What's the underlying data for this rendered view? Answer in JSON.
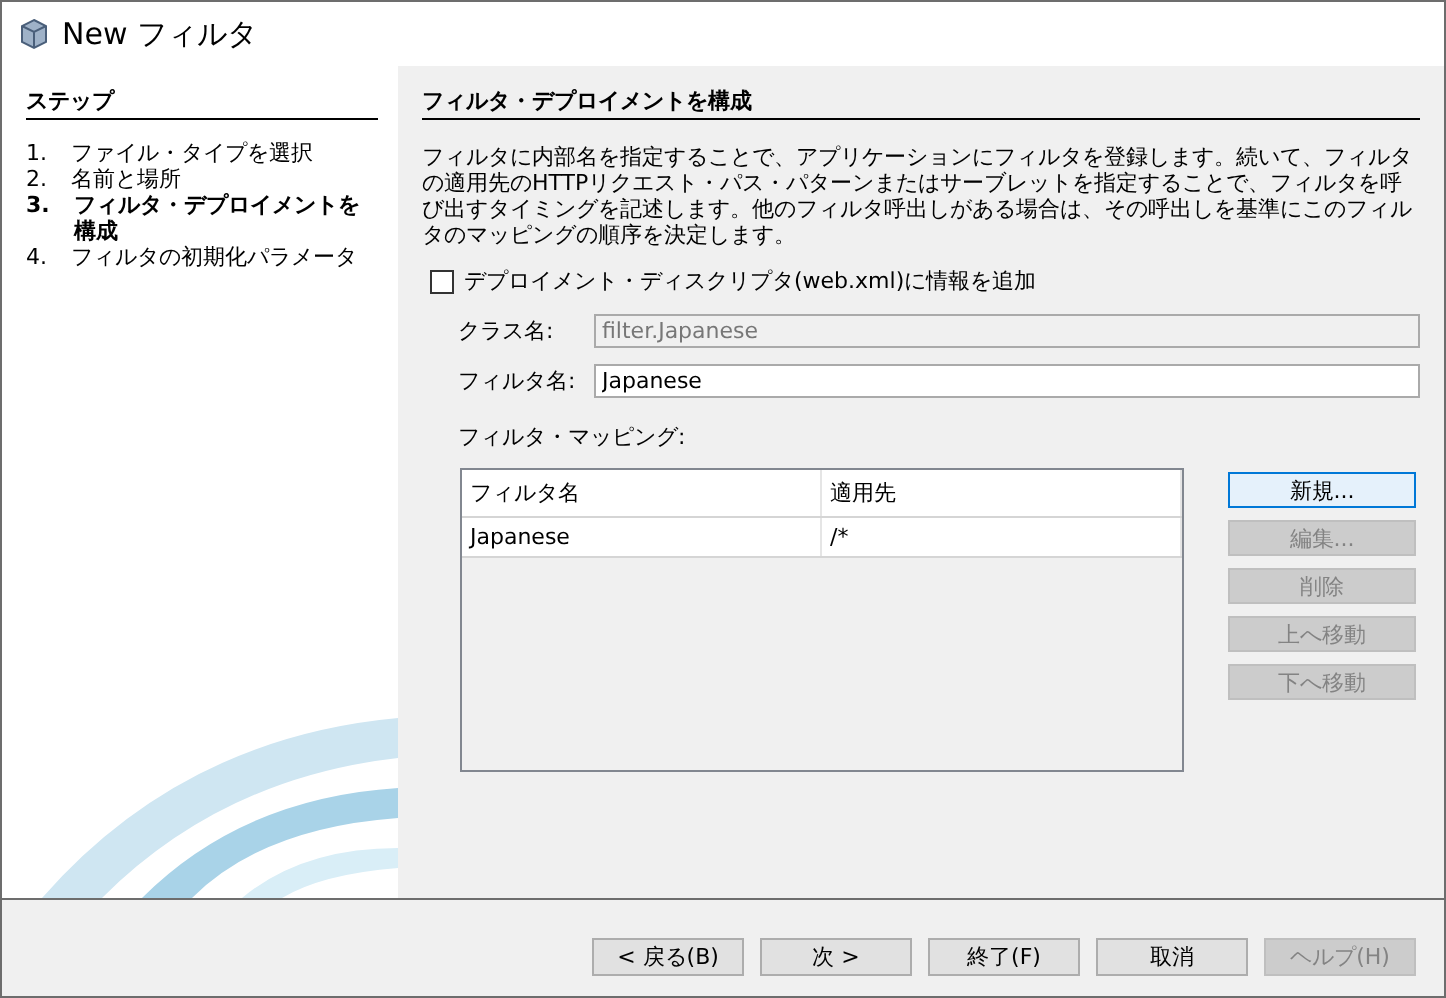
{
  "window": {
    "title": "New フィルタ"
  },
  "steps": {
    "heading": "ステップ",
    "items": [
      {
        "number": "1.",
        "label": "ファイル・タイプを選択",
        "selected": false
      },
      {
        "number": "2.",
        "label": "名前と場所",
        "selected": false
      },
      {
        "number": "3.",
        "label": "フィルタ・デプロイメントを構成",
        "selected": true
      },
      {
        "number": "4.",
        "label": "フィルタの初期化パラメータ",
        "selected": false
      }
    ]
  },
  "panel": {
    "heading": "フィルタ・デプロイメントを構成",
    "description": "フィルタに内部名を指定することで、アプリケーションにフィルタを登録します。続いて、フィルタの適用先のHTTPリクエスト・パス・パターンまたはサーブレットを指定することで、フィルタを呼び出すタイミングを記述します。他のフィルタ呼出しがある場合は、その呼出しを基準にこのフィルタのマッピングの順序を決定します。",
    "checkbox": {
      "label": "デプロイメント・ディスクリプタ(web.xml)に情報を追加",
      "checked": false
    },
    "fields": [
      {
        "label": "クラス名:",
        "value": "filter.Japanese",
        "disabled": true
      },
      {
        "label": "フィルタ名:",
        "value": "Japanese",
        "disabled": false
      }
    ],
    "mapping_label": "フィルタ・マッピング:",
    "table": {
      "columns": [
        "フィルタ名",
        "適用先"
      ],
      "rows": [
        [
          "Japanese",
          "/*"
        ]
      ]
    },
    "side_buttons": [
      {
        "label": "新規...",
        "disabled": false
      },
      {
        "label": "編集...",
        "disabled": true
      },
      {
        "label": "削除",
        "disabled": true
      },
      {
        "label": "上へ移動",
        "disabled": true
      },
      {
        "label": "下へ移動",
        "disabled": true
      }
    ]
  },
  "footer_buttons": [
    {
      "label": "< 戻る(B)",
      "disabled": false
    },
    {
      "label": "次 >",
      "disabled": false
    },
    {
      "label": "終了(F)",
      "disabled": false
    },
    {
      "label": "取消",
      "disabled": false
    },
    {
      "label": "ヘルプ(H)",
      "disabled": true
    }
  ]
}
